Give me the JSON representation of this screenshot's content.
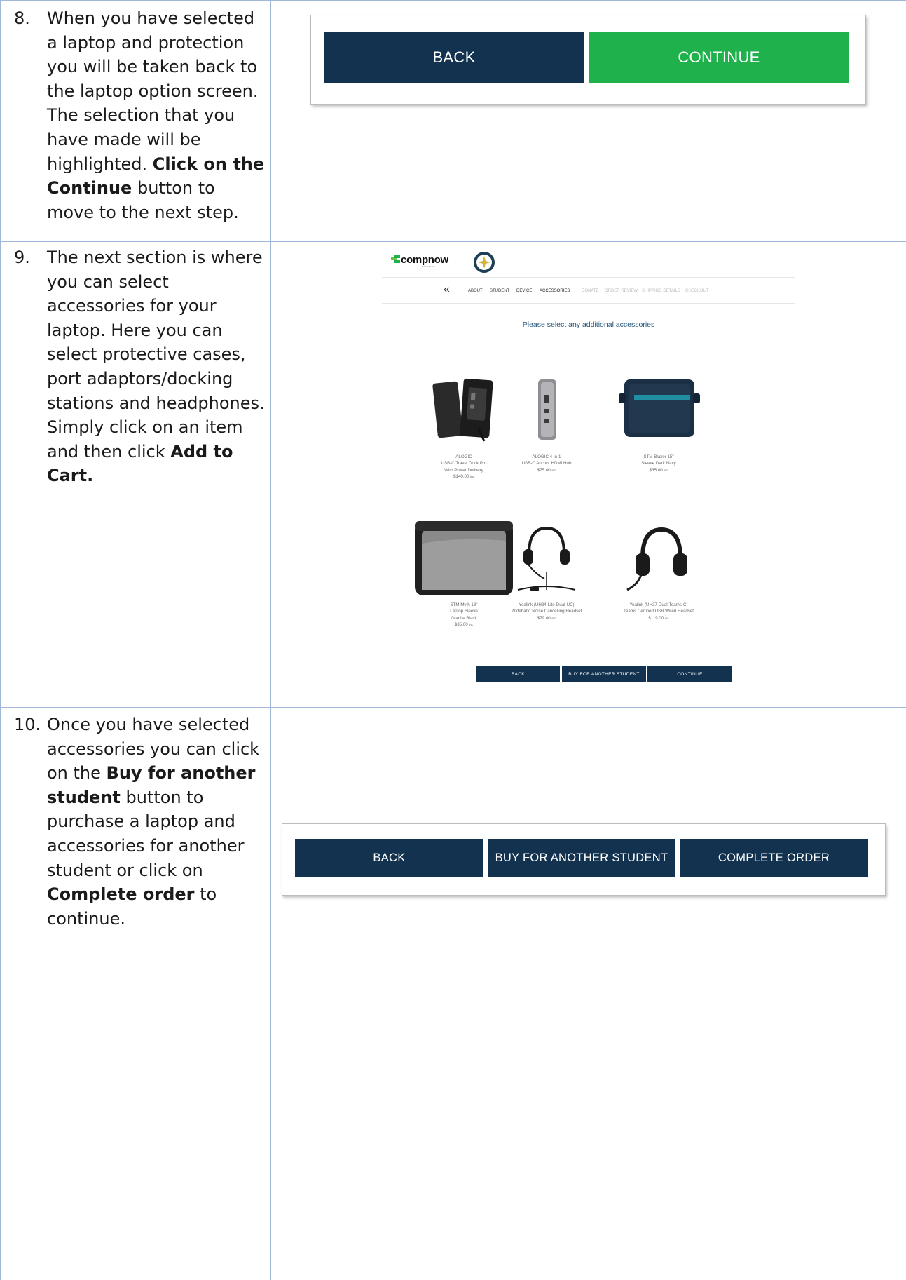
{
  "rows": [
    {
      "number": "8.",
      "text_before": "When you have selected a laptop and protection you will be taken back to the laptop option screen. The selection that you have made will be highlighted. ",
      "bold": "Click on the Continue",
      "text_after": " button to move to the next step."
    },
    {
      "number": "9.",
      "text_before": "The next section is where you can select accessories for your laptop. Here you can select protective cases, port adaptors/docking stations and headphones. Simply click on an item and then click ",
      "bold": "Add to Cart.",
      "text_after": ""
    },
    {
      "number": "10.",
      "text_1": "Once you have selected accessories you can click on the ",
      "bold_1": "Buy for another student",
      "text_2": " button to purchase a laptop and accessories for another student or click on ",
      "bold_2": "Complete order",
      "text_3": " to continue."
    }
  ],
  "shot1": {
    "back": "BACK",
    "continue": "CONTINUE"
  },
  "store": {
    "logo": "compnow",
    "logo_tagline": "IT built for you",
    "back_chevron": "«",
    "nav": [
      "ABOUT",
      "STUDENT",
      "DEVICE",
      "ACCESSORIES",
      "DONATE",
      "ORDER REVIEW",
      "SHIPPING DETAILS",
      "CHECKOUT"
    ],
    "heading": "Please select any additional accessories",
    "products": [
      {
        "lines": [
          "ALOGIC",
          "USB-C Travel Dock Pro",
          "With Power Delivery"
        ],
        "price": "$140.00",
        "tax": "inc",
        "image": "dock-image"
      },
      {
        "lines": [
          "ALOGIC 4-in-1",
          "USB-C Anchor HDMI Hub"
        ],
        "price": "$75.00",
        "tax": "inc",
        "image": "hub-image"
      },
      {
        "lines": [
          "STM Blazer 15\"",
          "Sleeve Dark Navy"
        ],
        "price": "$35.00",
        "tax": "inc",
        "image": "sleeve-navy-image"
      },
      {
        "lines": [
          "STM Myth 13\"",
          "Laptop Sleeve",
          "Granite Black"
        ],
        "price": "$35.00",
        "tax": "inc",
        "image": "sleeve-grey-image"
      },
      {
        "lines": [
          "Yealink (UH34-Lite-Dual-UC)",
          "Wideband Noise Cancelling Headset"
        ],
        "price": "$79.00",
        "tax": "inc",
        "image": "headset-image"
      },
      {
        "lines": [
          "Yealink (UH37-Dual-Teams-C)",
          "Teams Certified USB Wired Headset"
        ],
        "price": "$119.00",
        "tax": "inc",
        "image": "headset-image"
      }
    ],
    "buttons": {
      "back": "BACK",
      "buy_another": "BUY FOR ANOTHER STUDENT",
      "continue": "CONTINUE"
    }
  },
  "shot3": {
    "back": "BACK",
    "buy_another": "BUY FOR ANOTHER STUDENT",
    "complete": "COMPLETE ORDER"
  },
  "colors": {
    "navy": "#12324f",
    "green": "#1fb14b",
    "grid": "#9fb8da"
  }
}
